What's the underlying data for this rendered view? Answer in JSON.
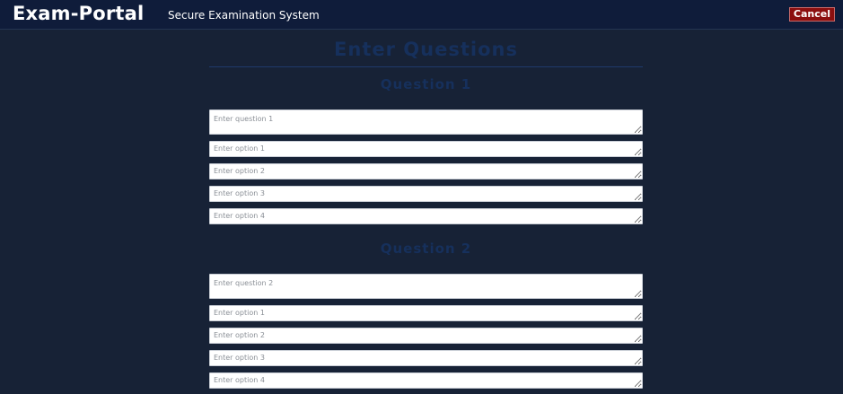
{
  "header": {
    "brand": "Exam-Portal",
    "subtitle": "Secure Examination System",
    "cancel_label": "Cancel"
  },
  "page": {
    "title": "Enter Questions"
  },
  "questions": [
    {
      "heading": "Question 1",
      "question_placeholder": "Enter question 1",
      "option_placeholders": [
        "Enter option 1",
        "Enter option 2",
        "Enter option 3",
        "Enter option 4"
      ]
    },
    {
      "heading": "Question 2",
      "question_placeholder": "Enter question 2",
      "option_placeholders": [
        "Enter option 1",
        "Enter option 2",
        "Enter option 3",
        "Enter option 4"
      ]
    }
  ],
  "colors": {
    "header_background": "#0f1c3a",
    "page_background": "#172236",
    "cancel_button": "#8b0f0f",
    "heading_text": "#16305c"
  }
}
